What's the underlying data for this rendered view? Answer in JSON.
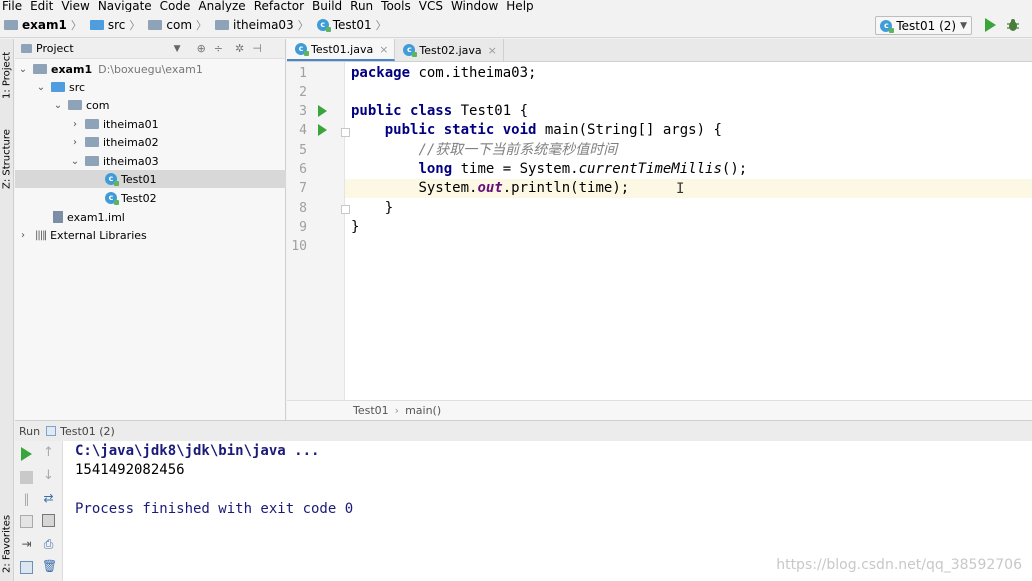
{
  "menu": [
    "File",
    "Edit",
    "View",
    "Navigate",
    "Code",
    "Analyze",
    "Refactor",
    "Build",
    "Run",
    "Tools",
    "VCS",
    "Window",
    "Help"
  ],
  "breadcrumb": [
    "exam1",
    "src",
    "com",
    "itheima03",
    "Test01"
  ],
  "run_config": "Test01 (2)",
  "left_stripe": {
    "project_tab": "1: Project",
    "structure_tab": "Z: Structure",
    "favorites_tab": "2: Favorites"
  },
  "project": {
    "header": "Project",
    "root": {
      "name": "exam1",
      "path": "D:\\boxuegu\\exam1"
    },
    "src": "src",
    "com": "com",
    "pkg1": "itheima01",
    "pkg2": "itheima02",
    "pkg3": "itheima03",
    "class1": "Test01",
    "class2": "Test02",
    "iml": "exam1.iml",
    "libs": "External Libraries"
  },
  "tabs": [
    "Test01.java",
    "Test02.java"
  ],
  "line_numbers": [
    "1",
    "2",
    "3",
    "4",
    "5",
    "6",
    "7",
    "8",
    "9",
    "10"
  ],
  "code": {
    "l1_kw": "package",
    "l1_rest": " com.itheima03;",
    "l3_kw": "public class",
    "l3_rest": " Test01 {",
    "l4_kw": "public static void",
    "l4_rest": " main(String[] args) {",
    "l5_comment": "//获取一下当前系统毫秒值时间",
    "l6_kw": "long",
    "l6_a": " time = System.",
    "l6_method": "currentTimeMillis",
    "l6_b": "();",
    "l7_a": "System.",
    "l7_field": "out",
    "l7_b": ".println(time);",
    "l8": "}",
    "l9": "}"
  },
  "editor_breadcrumb": [
    "Test01",
    "main()"
  ],
  "run_panel": {
    "label": "Run",
    "config": "Test01 (2)",
    "command": "C:\\java\\jdk8\\jdk\\bin\\java ...",
    "output": "1541492082456",
    "exit": "Process finished with exit code 0"
  },
  "watermark": "https://blog.csdn.net/qq_38592706",
  "colors": {
    "keyword": "#000080",
    "comment": "#808080",
    "field": "#660e7a",
    "run_green": "#3aa53a",
    "current_line": "#fcf8e3"
  }
}
